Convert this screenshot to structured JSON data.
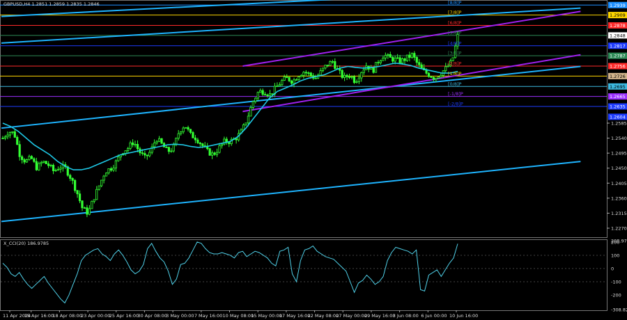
{
  "chart_data": [
    {
      "type": "line",
      "title": "GBPUSD,H4  1.2851 1.2859 1.2835 1.2846",
      "x_labels": [
        "11 Apr 2024",
        "15 Apr 16:00",
        "18 Apr 08:00",
        "23 Apr 00:00",
        "25 Apr 16:00",
        "30 Apr 08:00",
        "3 May 00:00",
        "7 May 16:00",
        "10 May 08:00",
        "15 May 00:00",
        "17 May 16:00",
        "22 May 08:00",
        "27 May 00:00",
        "29 May 16:00",
        "3 Jun 08:00",
        "6 Jun 00:00",
        "10 Jun 16:00"
      ],
      "y_ticks": [
        "1.2585",
        "1.2540",
        "1.2495",
        "1.2450",
        "1.2405",
        "1.2360",
        "1.2315",
        "1.2270"
      ],
      "price_tags": [
        {
          "text": "1.2939",
          "color": "#1e90ff"
        },
        {
          "text": "1.2909",
          "color": "#ffd700"
        },
        {
          "text": "1.2878",
          "color": "#ff2a2a"
        },
        {
          "text": "1.2848",
          "color": "#ffffff"
        },
        {
          "text": "1.2817",
          "color": "#1e3cff"
        },
        {
          "text": "1.2787",
          "color": "#2e8b57"
        },
        {
          "text": "1.2756",
          "color": "#ff2a2a"
        },
        {
          "text": "1.2726",
          "color": "#d2b48c"
        },
        {
          "text": "1.2695",
          "color": "#3cb8e0"
        },
        {
          "text": "1.2665",
          "color": "#9b30ff"
        },
        {
          "text": "1.2635",
          "color": "#1e3cff"
        },
        {
          "text": "1.2604",
          "color": "#1e3cff"
        }
      ],
      "murrey_levels": [
        {
          "text": "[8/8]P",
          "color": "#1e90ff",
          "price": 1.2939
        },
        {
          "text": "[7/8]P",
          "color": "#ffd700",
          "price": 1.2909
        },
        {
          "text": "[6/8]P",
          "color": "#ff2a2a",
          "price": 1.2878
        },
        {
          "text": "[5/8]P",
          "color": "#2e8b57",
          "price": 1.2848
        },
        {
          "text": "[4/8]P",
          "color": "#1e3cff",
          "price": 1.2817
        },
        {
          "text": "[3/8]P",
          "color": "#2e8b57",
          "price": 1.2787
        },
        {
          "text": "[2/8]P",
          "color": "#ff2a2a",
          "price": 1.2756
        },
        {
          "text": "[1/8]P",
          "color": "#ffd700",
          "price": 1.2726
        },
        {
          "text": "[0/8]P",
          "color": "#3cb8e0",
          "price": 1.2695
        },
        {
          "text": "[-1/8]P",
          "color": "#9b30ff",
          "price": 1.2665
        },
        {
          "text": "[-2/8]P",
          "color": "#1e3cff",
          "price": 1.2635
        }
      ],
      "ylim": [
        1.2245,
        1.295
      ],
      "close_series": [
        1.254,
        1.256,
        1.2555,
        1.249,
        1.247,
        1.248,
        1.245,
        1.247,
        1.246,
        1.244,
        1.2455,
        1.245,
        1.242,
        1.238,
        1.233,
        1.2315,
        1.236,
        1.24,
        1.244,
        1.245,
        1.247,
        1.25,
        1.251,
        1.253,
        1.25,
        1.248,
        1.25,
        1.254,
        1.252,
        1.25,
        1.251,
        1.256,
        1.258,
        1.255,
        1.254,
        1.252,
        1.25,
        1.249,
        1.251,
        1.253,
        1.253,
        1.254,
        1.256,
        1.26,
        1.265,
        1.268,
        1.268,
        1.267,
        1.269,
        1.271,
        1.272,
        1.271,
        1.273,
        1.274,
        1.273,
        1.272,
        1.274,
        1.276,
        1.277,
        1.274,
        1.272,
        1.273,
        1.271,
        1.274,
        1.276,
        1.274,
        1.277,
        1.279,
        1.278,
        1.2775,
        1.277,
        1.278,
        1.279,
        1.276,
        1.274,
        1.273,
        1.272,
        1.2735,
        1.275,
        1.277,
        1.2846
      ],
      "ma_series": [
        1.2585,
        1.2575,
        1.256,
        1.254,
        1.252,
        1.2505,
        1.249,
        1.247,
        1.2455,
        1.2445,
        1.2445,
        1.245,
        1.246,
        1.247,
        1.248,
        1.249,
        1.2495,
        1.25,
        1.2505,
        1.251,
        1.2515,
        1.252,
        1.2522,
        1.252,
        1.2515,
        1.2512,
        1.2515,
        1.252,
        1.2525,
        1.253,
        1.2545,
        1.257,
        1.26,
        1.263,
        1.266,
        1.268,
        1.269,
        1.27,
        1.2712,
        1.272,
        1.2725,
        1.273,
        1.274,
        1.275,
        1.2755,
        1.2752,
        1.275,
        1.2752,
        1.2755,
        1.276,
        1.2765,
        1.2762,
        1.2758,
        1.275,
        1.2745,
        1.274,
        1.2735,
        1.2735,
        1.274
      ],
      "trend_lines": [
        {
          "color": "#1eb4ff",
          "name": "channel-top",
          "from": [
            1.2905,
            0
          ],
          "to": [
            1.2958,
            0.57
          ]
        },
        {
          "color": "#1eb4ff",
          "name": "upper-long",
          "from": [
            1.2825,
            0
          ],
          "to": [
            1.293,
            0.96
          ]
        },
        {
          "color": "#1eb4ff",
          "name": "mid-long",
          "from": [
            1.257,
            0
          ],
          "to": [
            1.2755,
            0.96
          ]
        },
        {
          "color": "#1eb4ff",
          "name": "lower-long",
          "from": [
            1.229,
            0
          ],
          "to": [
            1.247,
            0.96
          ]
        },
        {
          "color": "#a020f0",
          "name": "purple-upper",
          "from": [
            1.2756,
            0.4
          ],
          "to": [
            1.292,
            0.96
          ]
        },
        {
          "color": "#a020f0",
          "name": "purple-lower",
          "from": [
            1.262,
            0.4
          ],
          "to": [
            1.279,
            0.96
          ]
        }
      ]
    },
    {
      "type": "line",
      "title": "X_CCI(20) 186.9785",
      "y_ticks": [
        "208.9767",
        "200",
        "100",
        "0",
        "-100",
        "-200",
        "-308.822"
      ],
      "ylim": [
        -310,
        210
      ],
      "values": [
        40,
        10,
        -40,
        -60,
        -30,
        -80,
        -120,
        -150,
        -120,
        -90,
        -60,
        -110,
        -150,
        -190,
        -230,
        -260,
        -200,
        -120,
        -40,
        60,
        100,
        120,
        140,
        150,
        110,
        90,
        60,
        110,
        140,
        100,
        50,
        -10,
        -40,
        -20,
        30,
        150,
        190,
        130,
        80,
        50,
        -20,
        -120,
        -80,
        30,
        40,
        80,
        140,
        200,
        190,
        150,
        120,
        110,
        110,
        120,
        110,
        100,
        80,
        120,
        130,
        90,
        110,
        130,
        120,
        100,
        80,
        40,
        20,
        130,
        140,
        160,
        -40,
        -100,
        60,
        140,
        150,
        170,
        130,
        110,
        90,
        80,
        70,
        40,
        10,
        -20,
        -100,
        -180,
        -110,
        -90,
        -50,
        -80,
        -120,
        -100,
        -60,
        60,
        120,
        160,
        150,
        140,
        130,
        110,
        140,
        -160,
        -170,
        -50,
        -30,
        -10,
        -60,
        -10,
        40,
        80,
        187
      ]
    }
  ]
}
